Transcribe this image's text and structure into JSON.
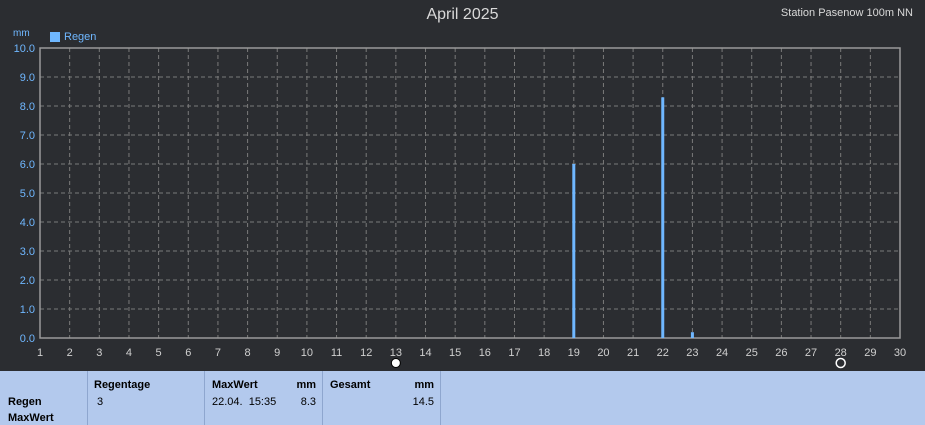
{
  "header": {
    "title": "April 2025",
    "station": "Station Pasenow 100m NN"
  },
  "chart_data": {
    "type": "bar",
    "title": "April 2025",
    "ylabel": "mm",
    "ylim": [
      0,
      10
    ],
    "y_ticks": [
      "0.0",
      "1.0",
      "2.0",
      "3.0",
      "4.0",
      "5.0",
      "6.0",
      "7.0",
      "8.0",
      "9.0",
      "10.0"
    ],
    "x_ticks": [
      "1",
      "2",
      "3",
      "4",
      "5",
      "6",
      "7",
      "8",
      "9",
      "10",
      "11",
      "12",
      "13",
      "14",
      "15",
      "16",
      "17",
      "18",
      "19",
      "20",
      "21",
      "22",
      "23",
      "24",
      "25",
      "26",
      "27",
      "28",
      "29",
      "30"
    ],
    "xlim": [
      1,
      30
    ],
    "grid": true,
    "legend": "top-left",
    "series": [
      {
        "name": "Regen",
        "color": "#6fb7ff",
        "points": [
          {
            "x": 19,
            "y": 6.0
          },
          {
            "x": 22,
            "y": 8.3
          },
          {
            "x": 23,
            "y": 0.2
          }
        ]
      }
    ],
    "markers": [
      {
        "x": 13,
        "icon": "full-moon-icon"
      },
      {
        "x": 28,
        "icon": "new-moon-icon"
      }
    ]
  },
  "summary": {
    "row_label": "Regen",
    "row_sublabel": "MaxWert",
    "regentage_label": "Regentage",
    "regentage_value": "3",
    "maxwert_label": "MaxWert",
    "maxwert_unit": "mm",
    "maxwert_time": "22.04.  15:35",
    "maxwert_value": "8.3",
    "gesamt_label": "Gesamt",
    "gesamt_unit": "mm",
    "gesamt_value": "14.5"
  }
}
